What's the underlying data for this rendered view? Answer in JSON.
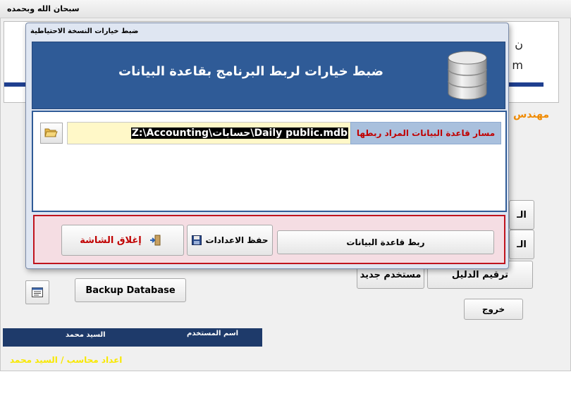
{
  "app": {
    "title": "سبحان الله وبحمده",
    "orange_heading": "مهندس"
  },
  "main": {
    "buttons": {
      "new_user": "مستخدم جديد",
      "numbering": "ترقيم الدليل",
      "exit": "خروج",
      "backup": "Backup Database",
      "partial_1": "الـ",
      "partial_2": "الـ"
    },
    "user_bar": {
      "label": "اسم المستخدم",
      "value": "السيد محمد"
    },
    "credit": "اعداد محاسب / السيد محمد"
  },
  "dialog": {
    "window_title": "ضبط خيارات النسخة الاحتياطية",
    "banner_title": "ضبط خيارات لربط البرنامج بقاعدة البيانات",
    "path_label": "مسار قاعدة البيانات المراد ربطها",
    "path_value": "Z:\\Accounting\\حسابات\\Daily public.mdb",
    "buttons": {
      "close_screen": "إغلاق الشاشة",
      "save_settings": "حفظ الاعدادات",
      "link_database": "ربط قاعدة البيانات"
    }
  },
  "colors": {
    "banner": "#2f5b97",
    "action_border": "#c0141e",
    "credit_text": "#f8e800",
    "orange_text": "#f08a00",
    "path_field_bg": "#fff8c8"
  },
  "icons": [
    "database-icon",
    "folder-open-icon",
    "floppy-disk-icon",
    "exit-door-icon",
    "form-list-icon"
  ]
}
